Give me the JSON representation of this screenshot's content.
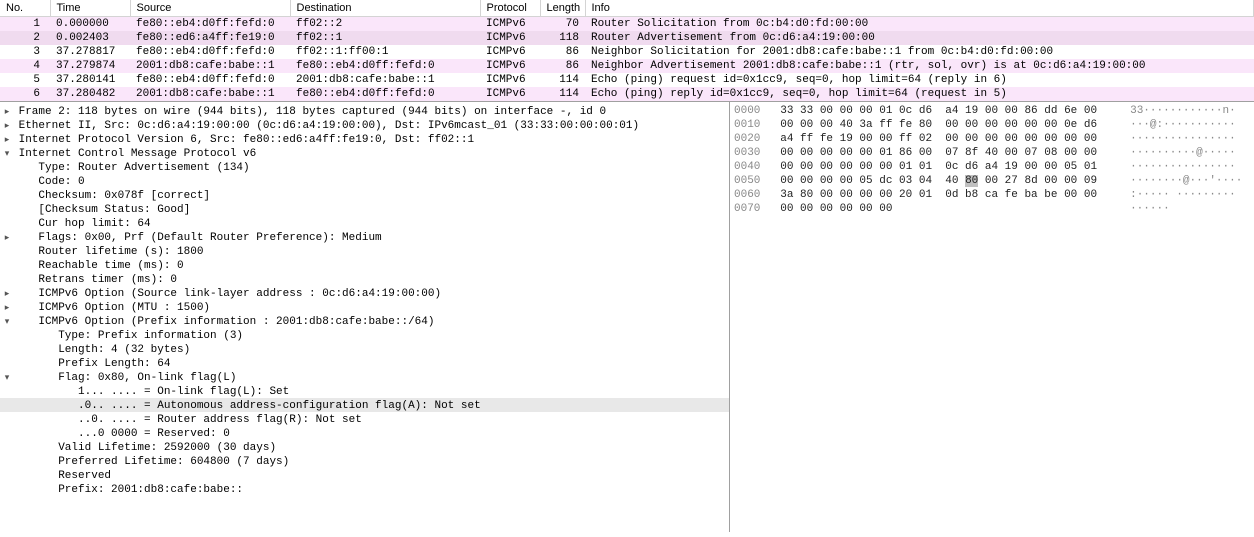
{
  "packet_list": {
    "headers": [
      "No.",
      "Time",
      "Source",
      "Destination",
      "Protocol",
      "Length",
      "Info"
    ],
    "rows": [
      {
        "no": "1",
        "time": "0.000000",
        "src": "fe80::eb4:d0ff:fefd:0",
        "dst": "ff02::2",
        "proto": "ICMPv6",
        "len": "70",
        "info": "Router Solicitation from 0c:b4:d0:fd:00:00",
        "cls": "pinkish"
      },
      {
        "no": "2",
        "time": "0.002403",
        "src": "fe80::ed6:a4ff:fe19:0",
        "dst": "ff02::1",
        "proto": "ICMPv6",
        "len": "118",
        "info": "Router Advertisement from 0c:d6:a4:19:00:00",
        "cls": "selected"
      },
      {
        "no": "3",
        "time": "37.278817",
        "src": "fe80::eb4:d0ff:fefd:0",
        "dst": "ff02::1:ff00:1",
        "proto": "ICMPv6",
        "len": "86",
        "info": "Neighbor Solicitation for 2001:db8:cafe:babe::1 from 0c:b4:d0:fd:00:00",
        "cls": "normal"
      },
      {
        "no": "4",
        "time": "37.279874",
        "src": "2001:db8:cafe:babe::1",
        "dst": "fe80::eb4:d0ff:fefd:0",
        "proto": "ICMPv6",
        "len": "86",
        "info": "Neighbor Advertisement 2001:db8:cafe:babe::1 (rtr, sol, ovr) is at 0c:d6:a4:19:00:00",
        "cls": "pinkish"
      },
      {
        "no": "5",
        "time": "37.280141",
        "src": "fe80::eb4:d0ff:fefd:0",
        "dst": "2001:db8:cafe:babe::1",
        "proto": "ICMPv6",
        "len": "114",
        "info": "Echo (ping) request id=0x1cc9, seq=0, hop limit=64 (reply in 6)",
        "cls": "normal"
      },
      {
        "no": "6",
        "time": "37.280482",
        "src": "2001:db8:cafe:babe::1",
        "dst": "fe80::eb4:d0ff:fefd:0",
        "proto": "ICMPv6",
        "len": "114",
        "info": "Echo (ping) reply id=0x1cc9, seq=0, hop limit=64 (request in 5)",
        "cls": "pinkish"
      }
    ]
  },
  "details": [
    {
      "tw": "▸",
      "ind": 0,
      "text": "Frame 2: 118 bytes on wire (944 bits), 118 bytes captured (944 bits) on interface -, id 0"
    },
    {
      "tw": "▸",
      "ind": 0,
      "text": "Ethernet II, Src: 0c:d6:a4:19:00:00 (0c:d6:a4:19:00:00), Dst: IPv6mcast_01 (33:33:00:00:00:01)"
    },
    {
      "tw": "▸",
      "ind": 0,
      "text": "Internet Protocol Version 6, Src: fe80::ed6:a4ff:fe19:0, Dst: ff02::1"
    },
    {
      "tw": "▾",
      "ind": 0,
      "text": "Internet Control Message Protocol v6"
    },
    {
      "tw": "",
      "ind": 1,
      "text": "Type: Router Advertisement (134)"
    },
    {
      "tw": "",
      "ind": 1,
      "text": "Code: 0"
    },
    {
      "tw": "",
      "ind": 1,
      "text": "Checksum: 0x078f [correct]"
    },
    {
      "tw": "",
      "ind": 1,
      "text": "[Checksum Status: Good]"
    },
    {
      "tw": "",
      "ind": 1,
      "text": "Cur hop limit: 64"
    },
    {
      "tw": "▸",
      "ind": 1,
      "text": "Flags: 0x00, Prf (Default Router Preference): Medium"
    },
    {
      "tw": "",
      "ind": 1,
      "text": "Router lifetime (s): 1800"
    },
    {
      "tw": "",
      "ind": 1,
      "text": "Reachable time (ms): 0"
    },
    {
      "tw": "",
      "ind": 1,
      "text": "Retrans timer (ms): 0"
    },
    {
      "tw": "▸",
      "ind": 1,
      "text": "ICMPv6 Option (Source link-layer address : 0c:d6:a4:19:00:00)"
    },
    {
      "tw": "▸",
      "ind": 1,
      "text": "ICMPv6 Option (MTU : 1500)"
    },
    {
      "tw": "▾",
      "ind": 1,
      "text": "ICMPv6 Option (Prefix information : 2001:db8:cafe:babe::/64)"
    },
    {
      "tw": "",
      "ind": 2,
      "text": "Type: Prefix information (3)"
    },
    {
      "tw": "",
      "ind": 2,
      "text": "Length: 4 (32 bytes)"
    },
    {
      "tw": "",
      "ind": 2,
      "text": "Prefix Length: 64"
    },
    {
      "tw": "▾",
      "ind": 2,
      "text": "Flag: 0x80, On-link flag(L)"
    },
    {
      "tw": "",
      "ind": 3,
      "text": "1... .... = On-link flag(L): Set"
    },
    {
      "tw": "",
      "ind": 3,
      "text": ".0.. .... = Autonomous address-configuration flag(A): Not set",
      "sel": true
    },
    {
      "tw": "",
      "ind": 3,
      "text": "..0. .... = Router address flag(R): Not set"
    },
    {
      "tw": "",
      "ind": 3,
      "text": "...0 0000 = Reserved: 0"
    },
    {
      "tw": "",
      "ind": 2,
      "text": "Valid Lifetime: 2592000 (30 days)"
    },
    {
      "tw": "",
      "ind": 2,
      "text": "Preferred Lifetime: 604800 (7 days)"
    },
    {
      "tw": "",
      "ind": 2,
      "text": "Reserved"
    },
    {
      "tw": "",
      "ind": 2,
      "text": "Prefix: 2001:db8:cafe:babe::"
    }
  ],
  "bytes": [
    {
      "off": "0000",
      "hex": "33 33 00 00 00 01 0c d6  a4 19 00 00 86 dd 6e 00",
      "asc": "33············n·"
    },
    {
      "off": "0010",
      "hex": "00 00 00 40 3a ff fe 80  00 00 00 00 00 00 0e d6",
      "asc": "···@:···········"
    },
    {
      "off": "0020",
      "hex": "a4 ff fe 19 00 00 ff 02  00 00 00 00 00 00 00 00",
      "asc": "················"
    },
    {
      "off": "0030",
      "hex": "00 00 00 00 00 01 86 00  07 8f 40 00 07 08 00 00",
      "asc": "··········@·····"
    },
    {
      "off": "0040",
      "hex": "00 00 00 00 00 00 01 01  0c d6 a4 19 00 00 05 01",
      "asc": "················"
    },
    {
      "off": "0050",
      "hex": "00 00 00 00 05 dc 03 04  40 ",
      "hexsel": "80",
      "hex2": " 00 27 8d 00 00 09",
      "asc": "········@···'····"
    },
    {
      "off": "0060",
      "hex": "3a 80 00 00 00 00 20 01  0d b8 ca fe ba be 00 00",
      "asc": ":····· ·········"
    },
    {
      "off": "0070",
      "hex": "00 00 00 00 00 00",
      "asc": "······"
    }
  ]
}
